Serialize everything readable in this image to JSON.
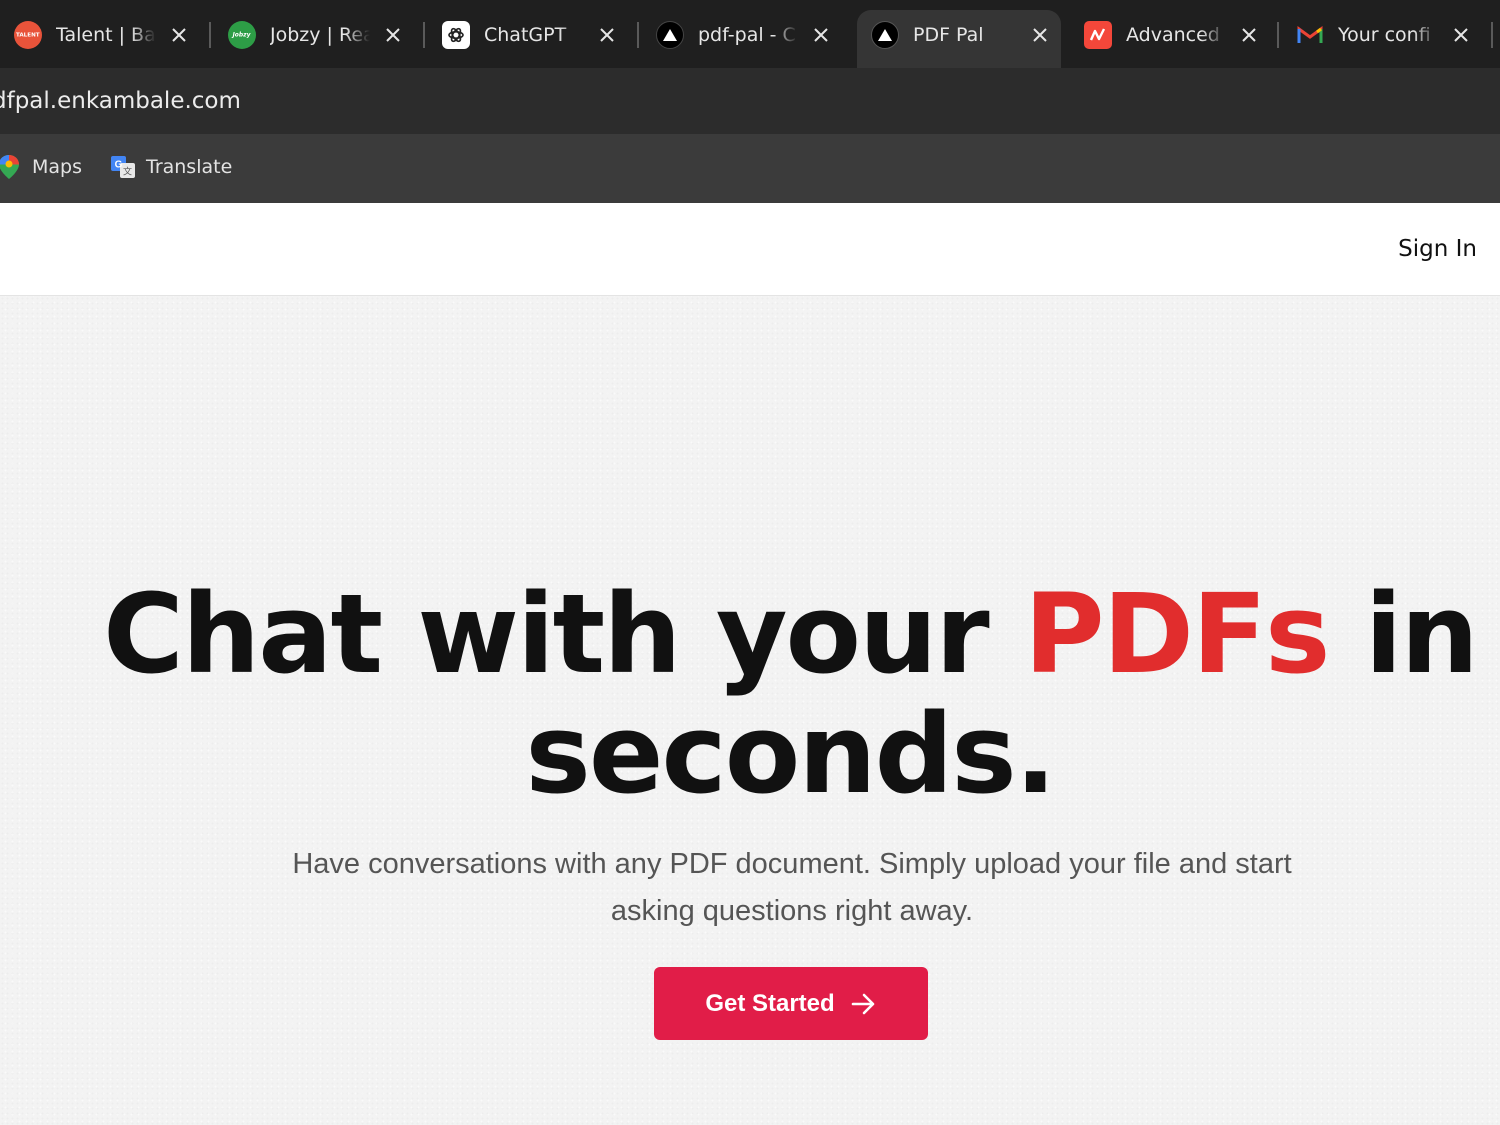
{
  "browser": {
    "tabs": [
      {
        "title": "Talent | Bac",
        "favicon": "talent-icon",
        "favicon_text": "TALENT",
        "favicon_color": "#e8533a",
        "active": false
      },
      {
        "title": "Jobzy | Rea",
        "favicon": "jobzy-icon",
        "favicon_text": "Jobzy",
        "favicon_color": "#2d9d46",
        "active": false
      },
      {
        "title": "ChatGPT",
        "favicon": "chatgpt-icon",
        "favicon_color": "#ffffff",
        "active": false
      },
      {
        "title": "pdf-pal - C",
        "favicon": "vercel-icon",
        "favicon_color": "#000000",
        "active": false
      },
      {
        "title": "PDF Pal",
        "favicon": "vercel-icon",
        "favicon_color": "#000000",
        "active": true
      },
      {
        "title": "Advanced",
        "favicon": "advanced-icon",
        "favicon_color": "#f4473a",
        "active": false
      },
      {
        "title": "Your confi",
        "favicon": "gmail-icon",
        "favicon_color": "#ea4335",
        "active": false
      }
    ],
    "url": "dfpal.enkambale.com",
    "bookmarks": [
      {
        "label": "Maps",
        "icon": "maps-icon"
      },
      {
        "label": "Translate",
        "icon": "translate-icon"
      }
    ]
  },
  "header": {
    "signin_label": "Sign In"
  },
  "hero": {
    "headline_before": "Chat with your ",
    "headline_accent": "PDFs",
    "headline_after": " in seconds.",
    "subtitle": "Have conversations with any PDF document. Simply upload your file and start asking questions right away.",
    "cta_label": "Get Started"
  },
  "colors": {
    "accent_text": "#e12d2d",
    "cta_background": "#e11d48",
    "tabstrip": "#1f1f1f",
    "active_tab": "#353535"
  }
}
